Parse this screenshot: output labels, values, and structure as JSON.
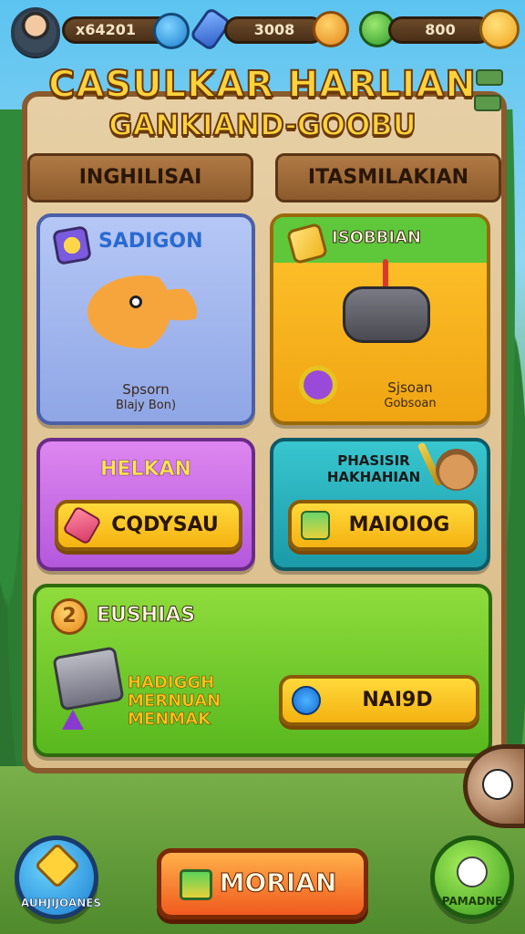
{
  "hud": {
    "counter_1": "x64201",
    "counter_2": "3008",
    "counter_3": "800"
  },
  "title": {
    "line1": "CASULKAR HARLIAN",
    "line2": "GANKIAND-GOOBU"
  },
  "tabs": [
    {
      "label": "INGHILISAI"
    },
    {
      "label": "ITASMILAKIAN"
    }
  ],
  "cards": {
    "pets": {
      "title": "SADIGON",
      "caption": "Spsorn",
      "sub": "Blajy Bon)"
    },
    "controller": {
      "title": "ISOBBIAN",
      "caption": "Sjsoan",
      "sub": "Gobsoan"
    },
    "purple": {
      "title": "HELKAN",
      "button": "CQDYSAU"
    },
    "teal": {
      "title": "PHASISIR HAKHAHIAN",
      "button": "MAIOIOG"
    },
    "green": {
      "title": "EUSHIAS",
      "lines": [
        "HADIGGH",
        "MERNUAN",
        "MENMAK"
      ],
      "button": "NAI9D",
      "coin_glyph": "2"
    }
  },
  "bottom": {
    "left_button": "AUHJIJOANES",
    "main_button": "MORIAN",
    "right_button": "PAMADNE"
  },
  "colors": {
    "accent_yellow": "#ffd23c",
    "wood": "#8a5a2e",
    "card_blue": "#8fa6e6",
    "card_yellow": "#f0a412",
    "card_purple": "#b458dc",
    "card_teal": "#1b9aa8",
    "card_green": "#58b81e",
    "main_orange": "#f05a1e"
  },
  "icons": [
    "avatar",
    "blob-icon",
    "bottle-icon",
    "coin-icon",
    "gem-icon",
    "star-icon",
    "pet-icon",
    "gamepad-icon",
    "bear-icon",
    "gift-icon",
    "cards-icon",
    "potion-icon",
    "cat-icon"
  ]
}
